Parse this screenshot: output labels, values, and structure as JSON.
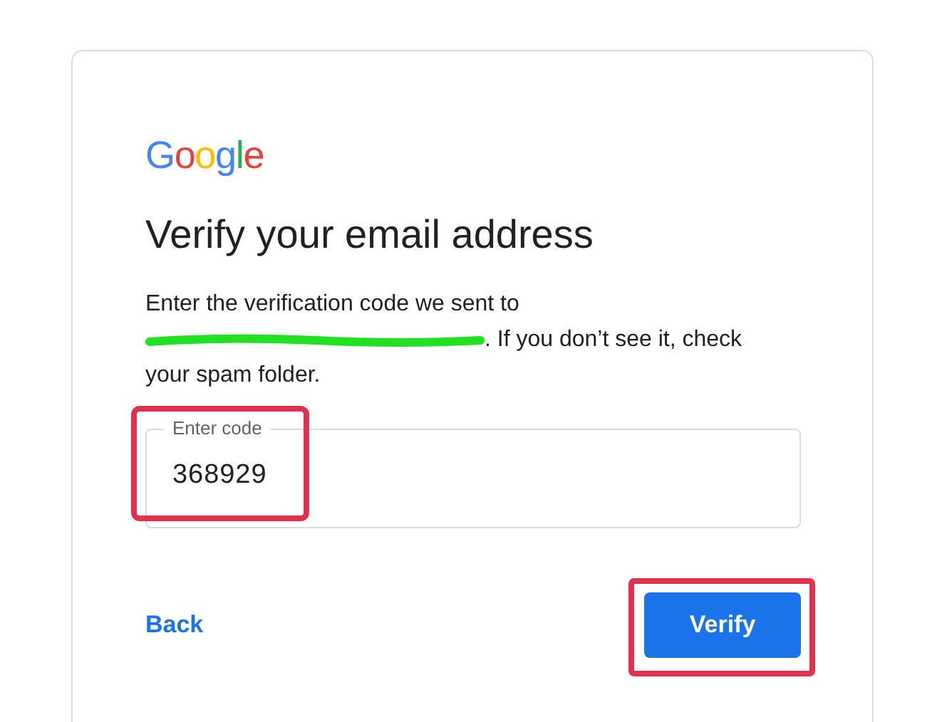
{
  "logo": {
    "text": "Google"
  },
  "heading": "Verify your email address",
  "message": {
    "before": "Enter the verification code we sent to",
    "after": ". If you don’t see it, check your spam folder.",
    "email_redacted": true
  },
  "code_field": {
    "label": "Enter code",
    "value": "368929",
    "highlighted": true
  },
  "back_link": "Back",
  "verify_button": {
    "label": "Verify",
    "highlighted": true
  }
}
